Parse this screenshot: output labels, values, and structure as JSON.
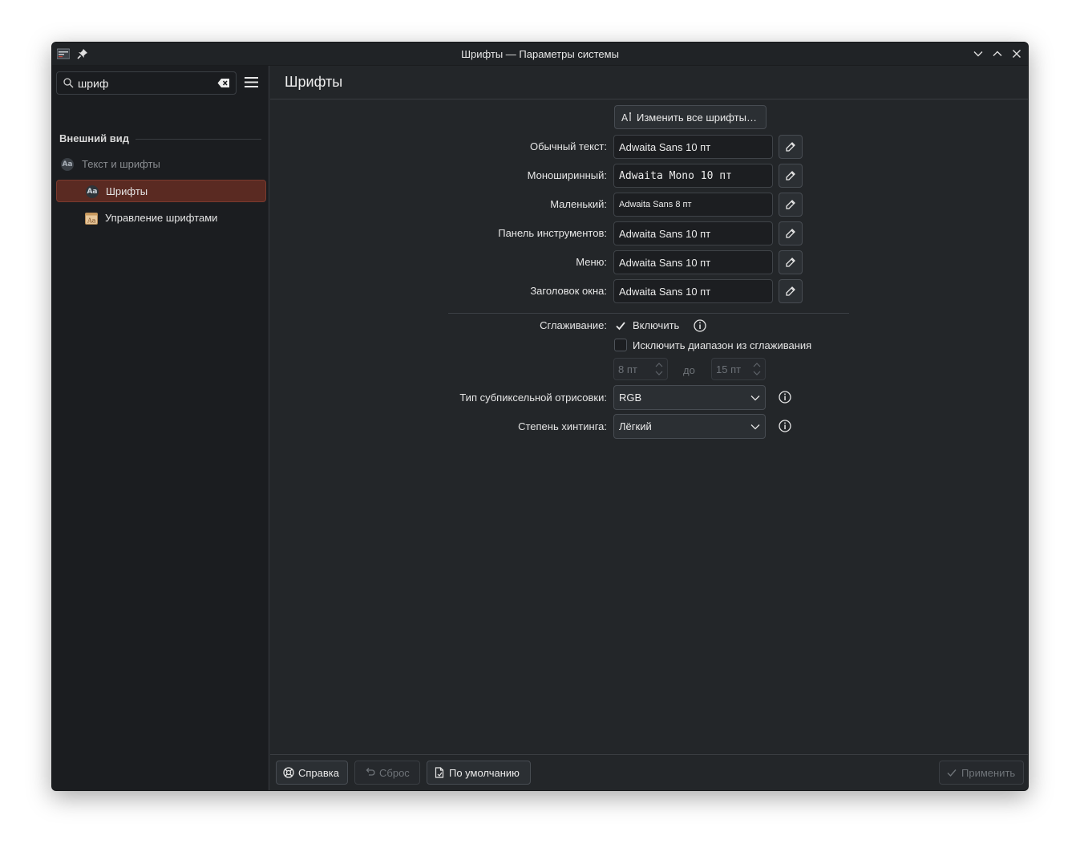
{
  "window": {
    "title": "Шрифты — Параметры системы"
  },
  "sidebar": {
    "search": {
      "value": "шриф"
    },
    "category": "Внешний вид",
    "items": [
      {
        "label": "Текст и шрифты",
        "icon": "text-fonts-icon",
        "state": "dimmed"
      },
      {
        "label": "Шрифты",
        "icon": "fonts-icon",
        "state": "selected"
      },
      {
        "label": "Управление шрифтами",
        "icon": "font-management-icon",
        "state": "normal"
      }
    ]
  },
  "main": {
    "title": "Шрифты",
    "change_all_label": "Изменить все шрифты…",
    "fonts": [
      {
        "label": "Обычный текст:",
        "value": "Adwaita Sans 10 пт"
      },
      {
        "label": "Моноширинный:",
        "value": "Adwaita Mono 10 пт"
      },
      {
        "label": "Маленький:",
        "value": "Adwaita Sans 8 пт"
      },
      {
        "label": "Панель инструментов:",
        "value": "Adwaita Sans 10 пт"
      },
      {
        "label": "Меню:",
        "value": "Adwaita Sans 10 пт"
      },
      {
        "label": "Заголовок окна:",
        "value": "Adwaita Sans 10 пт"
      }
    ],
    "antialiasing": {
      "label": "Сглаживание:",
      "enable_label": "Включить",
      "enable_checked": true,
      "exclude_label": "Исключить диапазон из сглаживания",
      "exclude_checked": false,
      "range_from": "8 пт",
      "range_to_label": "до",
      "range_to": "15 пт"
    },
    "subpixel": {
      "label": "Тип субпиксельной отрисовки:",
      "value": "RGB"
    },
    "hinting": {
      "label": "Степень хинтинга:",
      "value": "Лёгкий"
    }
  },
  "footer": {
    "help_label": "Справка",
    "reset_label": "Сброс",
    "defaults_label": "По умолчанию",
    "apply_label": "Применить"
  },
  "colors": {
    "window_bg": "#232629",
    "sidebar_bg": "#1b1d20",
    "selection": "#5a2a22",
    "accent_check": "#e8e8e8"
  }
}
